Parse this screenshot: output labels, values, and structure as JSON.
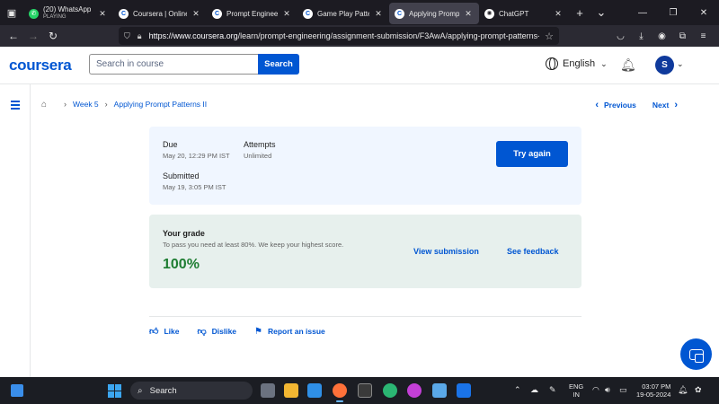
{
  "browser": {
    "tabs": [
      {
        "title": "(20) WhatsApp",
        "subtitle": "PLAYING",
        "icon": "whatsapp-icon"
      },
      {
        "title": "Coursera | Online C",
        "icon": "coursera-icon"
      },
      {
        "title": "Prompt Engineering",
        "icon": "coursera-icon"
      },
      {
        "title": "Game Play Pattern |",
        "icon": "coursera-icon"
      },
      {
        "title": "Applying Prompt Pa",
        "icon": "coursera-icon",
        "active": true
      },
      {
        "title": "ChatGPT",
        "icon": "chatgpt-icon"
      }
    ],
    "url_host": "https://www.coursera.org",
    "url_path": "/learn/prompt-engineering/assignment-submission/F3AwA/applying-prompt-patterns-"
  },
  "header": {
    "logo": "coursera",
    "search_placeholder": "Search in course",
    "search_button": "Search",
    "language": "English",
    "avatar_initial": "S"
  },
  "breadcrumb": {
    "items": [
      "Week 5",
      "Applying Prompt Patterns II"
    ],
    "previous": "Previous",
    "next": "Next"
  },
  "due_card": {
    "due_label": "Due",
    "due_value": "May 20, 12:29 PM IST",
    "attempts_label": "Attempts",
    "attempts_value": "Unlimited",
    "submitted_label": "Submitted",
    "submitted_value": "May 19, 3:05 PM IST",
    "try_again": "Try again"
  },
  "grade_card": {
    "title": "Your grade",
    "note": "To pass you need at least 80%. We keep your highest score.",
    "score": "100%",
    "view_submission": "View submission",
    "see_feedback": "See feedback"
  },
  "actions": {
    "like": "Like",
    "dislike": "Dislike",
    "report": "Report an issue"
  },
  "taskbar": {
    "search": "Search",
    "lang_top": "ENG",
    "lang_bottom": "IN",
    "time": "03:07 PM",
    "date": "19-05-2024"
  },
  "colors": {
    "brand": "#0056d2",
    "score_green": "#1e7d32",
    "due_bg": "#f0f6ff",
    "grade_bg": "#e7f0ed"
  }
}
